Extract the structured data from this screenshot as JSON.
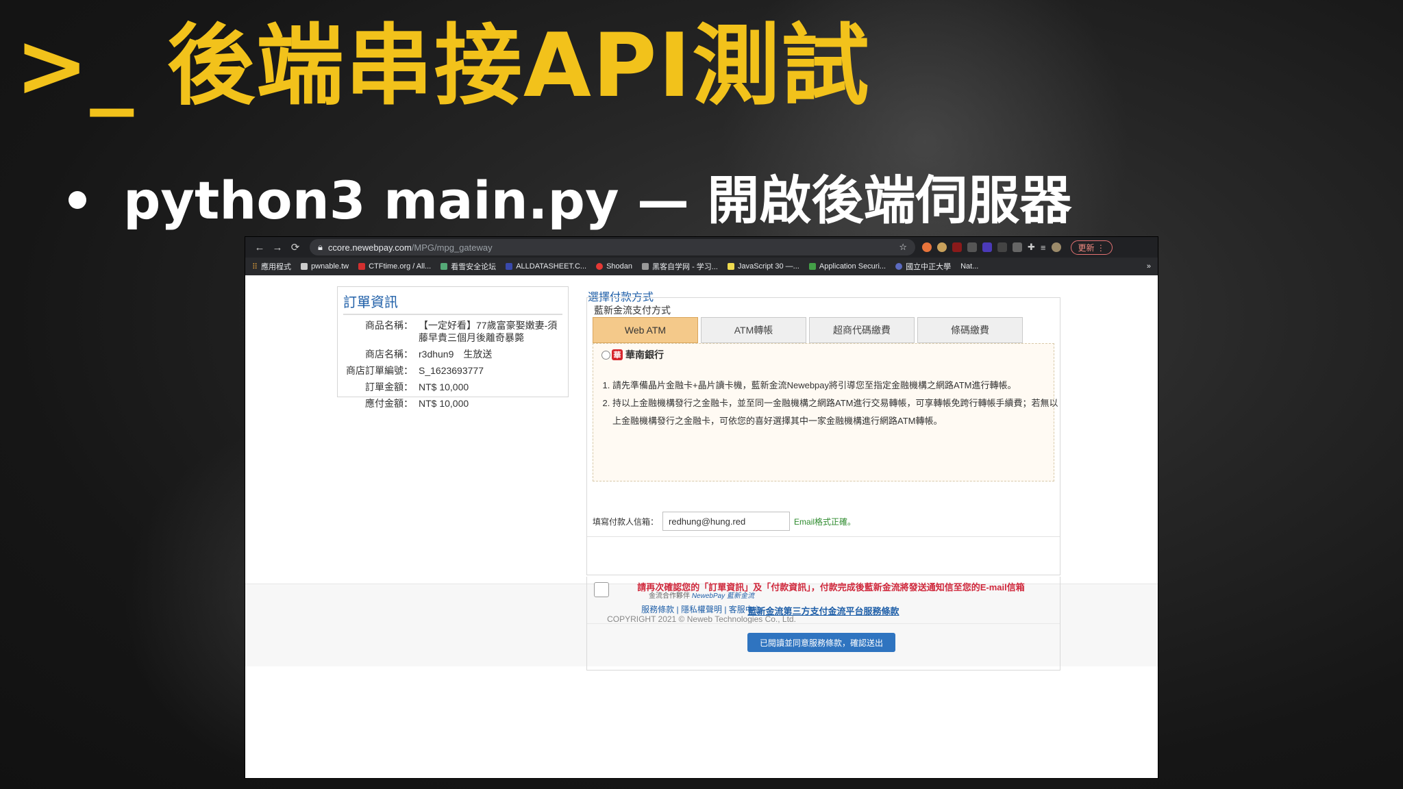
{
  "slide": {
    "title": ">_ 後端串接API測試",
    "bullet": "python3 main.py — 開啟後端伺服器"
  },
  "browser": {
    "nav": {
      "back": "←",
      "forward": "→",
      "reload": "⟳"
    },
    "url_host": "ccore.newebpay.com",
    "url_path": "/MPG/mpg_gateway",
    "update_label": "更新",
    "bookmarks": [
      "應用程式",
      "pwnable.tw",
      "CTFtime.org / All...",
      "看雪安全论坛",
      "ALLDATASHEET.C...",
      "Shodan",
      "黑客自学网 - 学习...",
      "JavaScript 30 —...",
      "Application Securi...",
      "國立中正大學",
      "Nat..."
    ],
    "more": "»"
  },
  "order": {
    "title": "訂單資訊",
    "rows": [
      {
        "label": "商品名稱：",
        "value": "【一定好看】77歲富豪娶嫩妻-須藤早貴三個月後離奇暴斃"
      },
      {
        "label": "商店名稱：",
        "value": "r3dhun9　生放送"
      },
      {
        "label": "商店訂單編號：",
        "value": "S_1623693777"
      },
      {
        "label": "訂單金額：",
        "value": "NT$ 10,000"
      },
      {
        "label": "應付金額：",
        "value": "NT$ 10,000"
      }
    ]
  },
  "payment": {
    "header": "選擇付款方式",
    "method_label": "藍新金流支付方式",
    "tabs": [
      "Web ATM",
      "ATM轉帳",
      "超商代碼繳費",
      "條碼繳費"
    ],
    "bank_name": "華南銀行",
    "bank_logo_char": "華",
    "notes": [
      "請先準備晶片金融卡+晶片讀卡機，藍新金流Newebpay將引導您至指定金融機構之網路ATM進行轉帳。",
      "持以上金融機構發行之金融卡，並至同一金融機構之網路ATM進行交易轉帳，可享轉帳免跨行轉帳手續費；若無以上金融機構發行之金融卡，可依您的喜好選擇其中一家金融機構進行網路ATM轉帳。"
    ],
    "email_label": "填寫付款人信箱：",
    "email_value": "redhung@hung.red",
    "email_ok": "Email格式正確。"
  },
  "confirm": {
    "text": "請再次確認您的「訂單資訊」及「付款資訊」，付款完成後藍新金流將發送通知信至您的E-mail信箱",
    "terms_link": "藍新金流第三方支付金流平台服務條款",
    "submit": "已閱讀並同意服務條款，確認送出"
  },
  "footer": {
    "partner_label": "金流合作夥伴",
    "partner_brand": "NewebPay 藍新金流",
    "links": [
      "服務條款",
      "隱私權聲明",
      "客服中心"
    ],
    "copyright": "COPYRIGHT 2021 © Neweb Technologies Co., Ltd."
  },
  "colors": {
    "title": "#f2c21b",
    "active_tab": "#f4c98a",
    "link": "#1f5fa8",
    "warning": "#d0283c",
    "button": "#2f74c0"
  }
}
